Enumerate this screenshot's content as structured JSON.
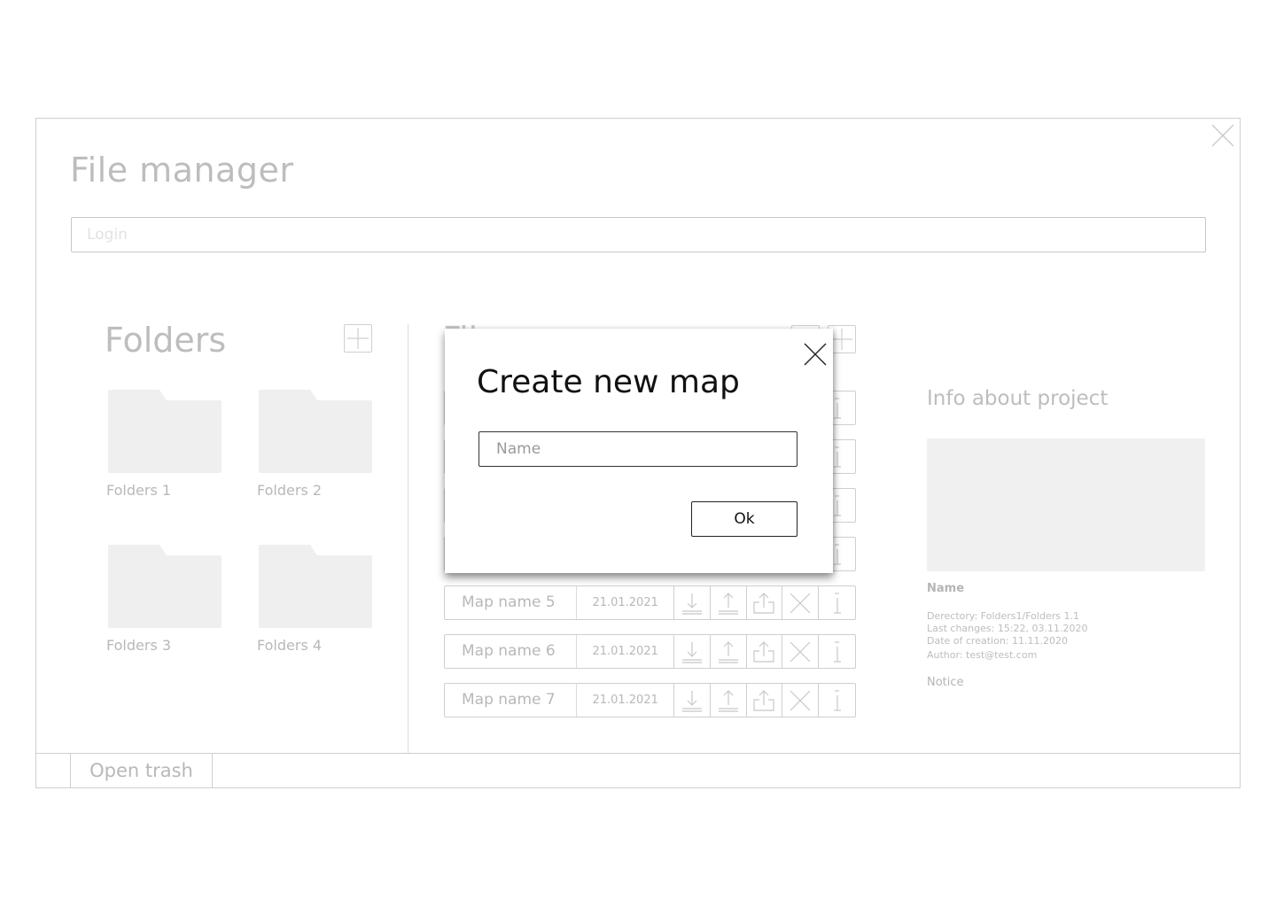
{
  "app": {
    "title": "File manager",
    "login_placeholder": "Login"
  },
  "folders": {
    "title": "Folders",
    "items": [
      {
        "label": "Folders 1"
      },
      {
        "label": "Folders 2"
      },
      {
        "label": "Folders 3"
      },
      {
        "label": "Folders 4"
      }
    ],
    "add_icon": "plus-icon"
  },
  "files": {
    "title": "Files",
    "header_icons": [
      "upload-icon",
      "plus-icon"
    ],
    "rows": [
      {
        "name": "Map name 5",
        "date": "21.01.2021"
      },
      {
        "name": "Map name 6",
        "date": "21.01.2021"
      },
      {
        "name": "Map name 7",
        "date": "21.01.2021"
      }
    ],
    "row_actions": [
      "download-icon",
      "upload-icon",
      "share-icon",
      "delete-icon",
      "info-icon"
    ]
  },
  "info": {
    "title": "Info about project",
    "name_label": "Name",
    "directory": "Derectory: Folders1/Folders 1.1",
    "last_changes": "Last changes: 15:22, 03.11.2020",
    "date_of_creation": "Date of creation: 11.11.2020",
    "author": "Author: test@test.com",
    "notice": "Notice"
  },
  "footer": {
    "trash_label": "Open trash"
  },
  "modal": {
    "title": "Create new map",
    "name_placeholder": "Name",
    "ok_label": "Ok"
  }
}
